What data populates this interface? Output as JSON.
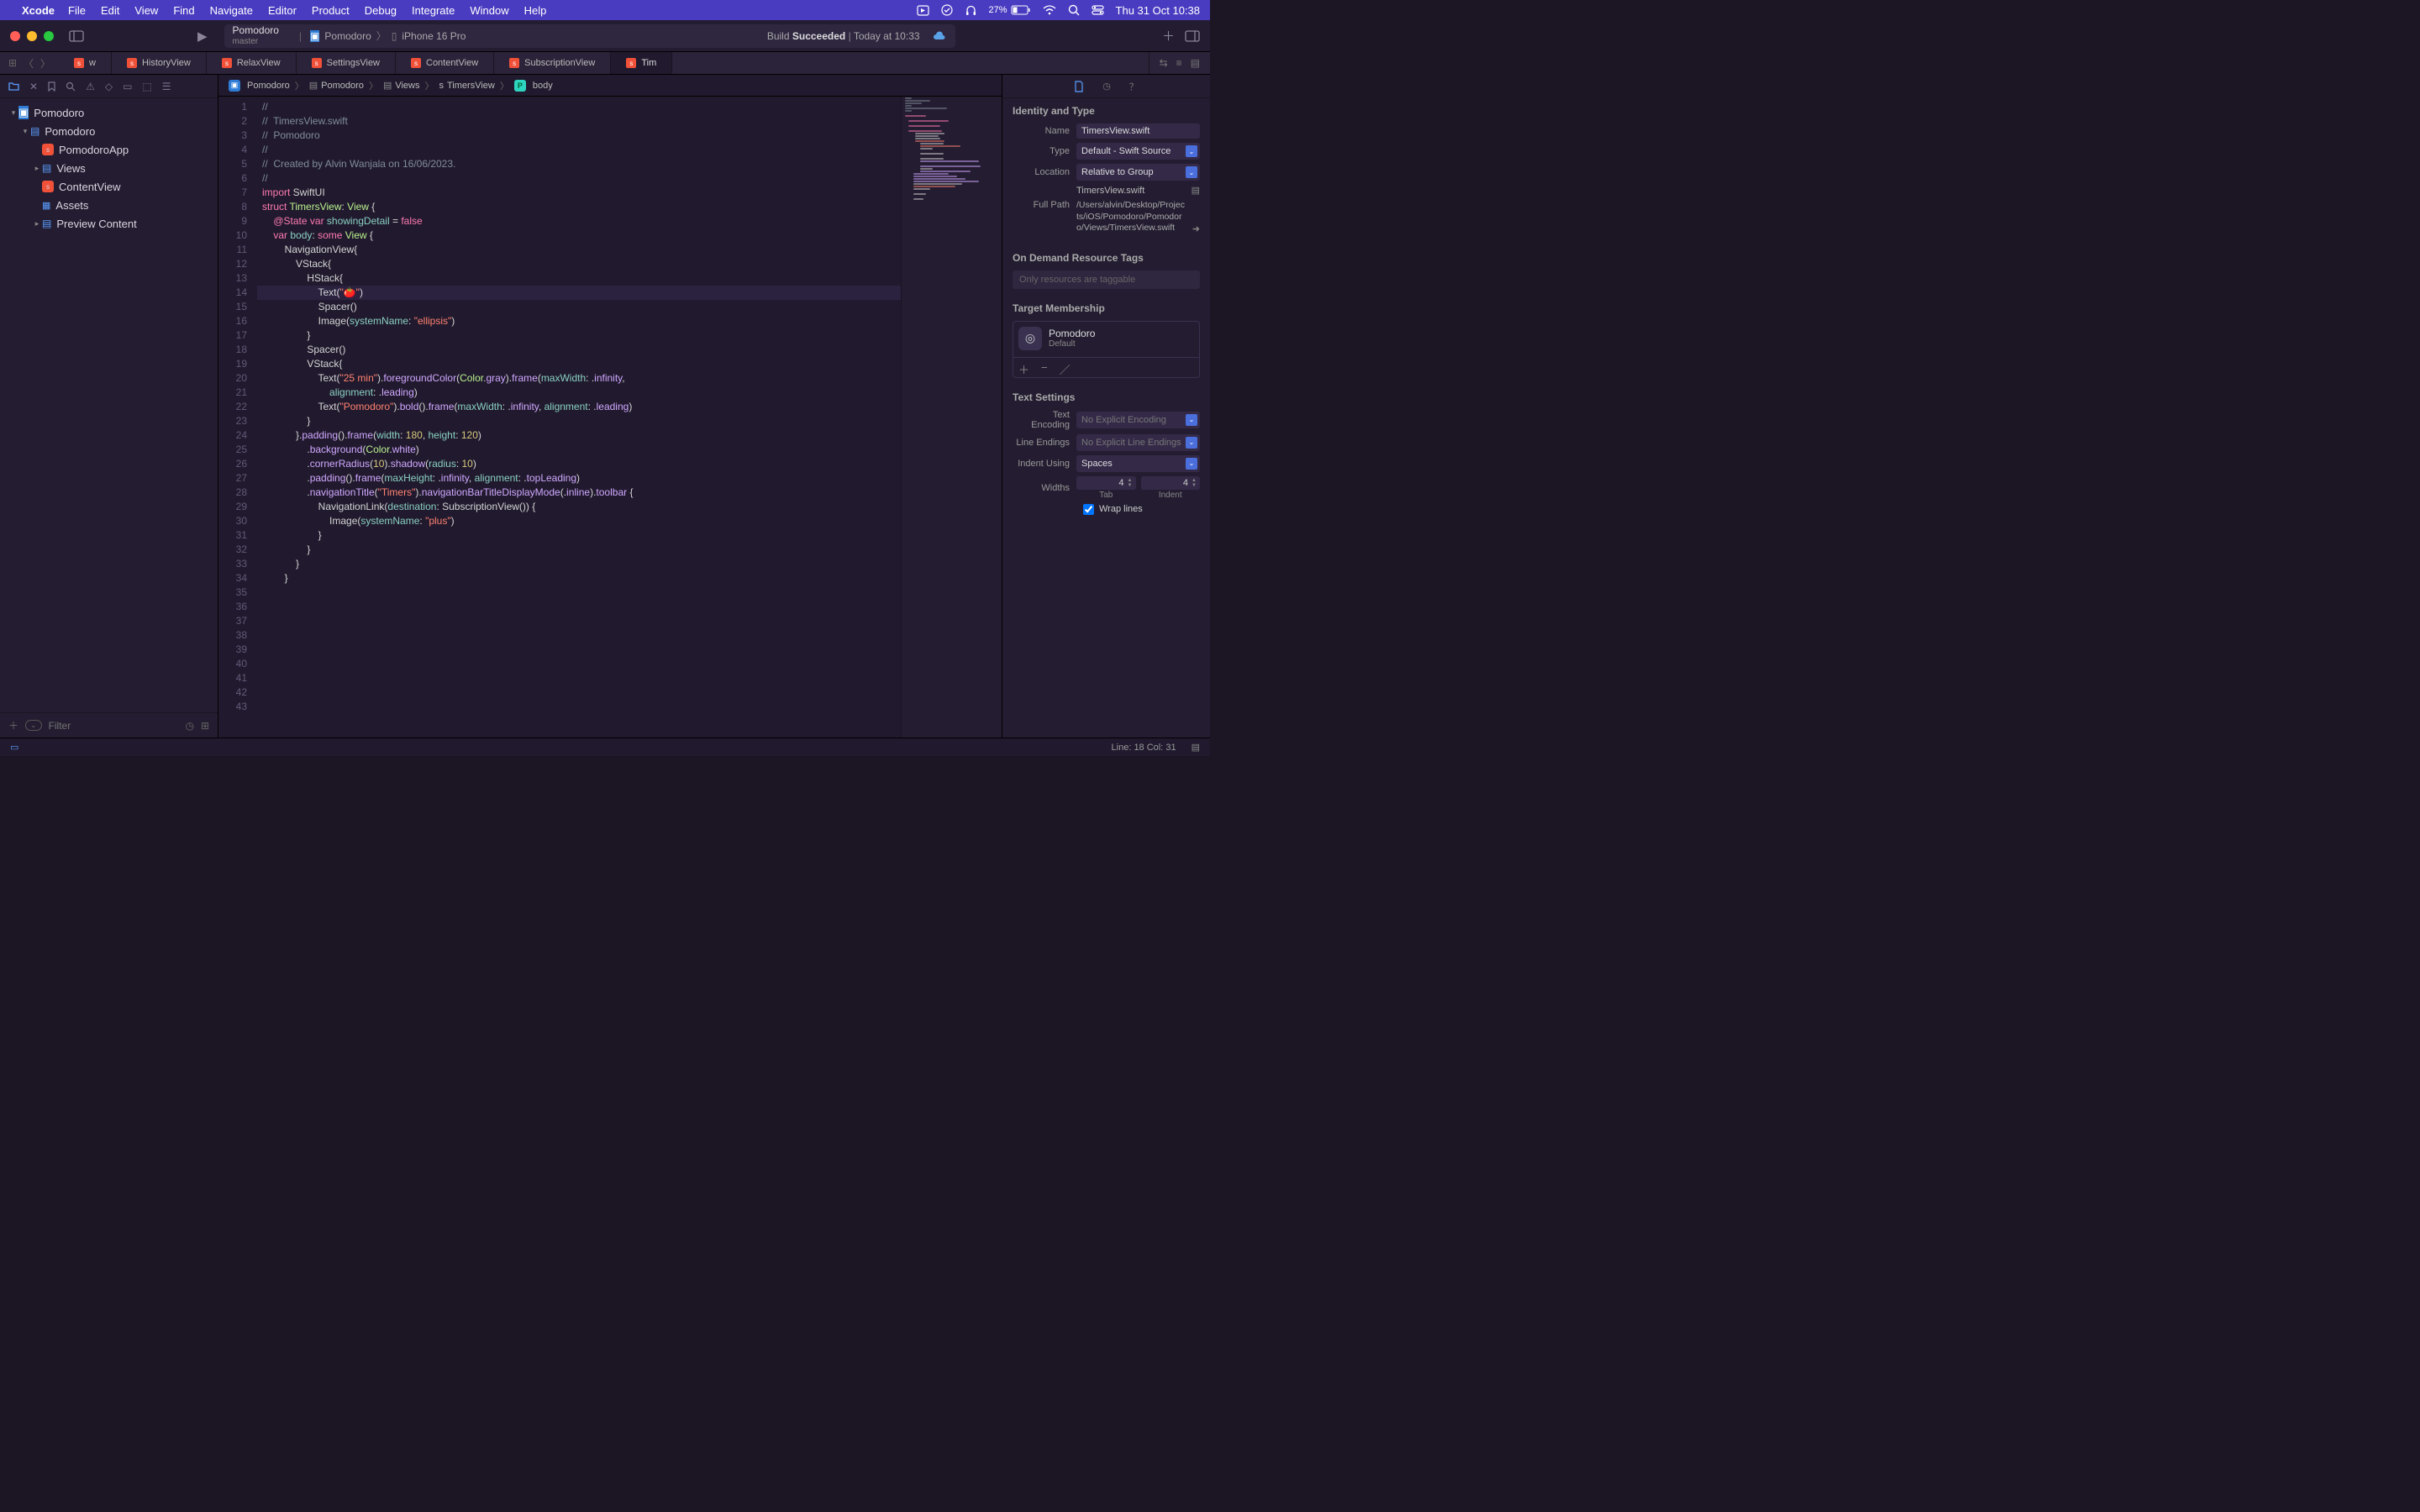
{
  "menubar": {
    "app": "Xcode",
    "items": [
      "File",
      "Edit",
      "View",
      "Find",
      "Navigate",
      "Editor",
      "Product",
      "Debug",
      "Integrate",
      "Window",
      "Help"
    ],
    "battery_pct": "27%",
    "datetime": "Thu 31 Oct  10:38"
  },
  "toolbar": {
    "project": "Pomodoro",
    "branch": "master",
    "scheme_app": "Pomodoro",
    "scheme_device": "iPhone 16 Pro",
    "build_label": "Build",
    "build_status": "Succeeded",
    "build_time": "Today at 10:33"
  },
  "tabs": [
    {
      "label": "w",
      "partial": true
    },
    {
      "label": "HistoryView"
    },
    {
      "label": "RelaxView"
    },
    {
      "label": "SettingsView"
    },
    {
      "label": "ContentView"
    },
    {
      "label": "SubscriptionView"
    },
    {
      "label": "Tim",
      "active": true,
      "partial": true
    }
  ],
  "navigator": {
    "tree": [
      {
        "depth": 0,
        "kind": "project",
        "label": "Pomodoro",
        "disclosed": true
      },
      {
        "depth": 1,
        "kind": "folder",
        "label": "Pomodoro",
        "disclosed": true
      },
      {
        "depth": 2,
        "kind": "swift",
        "label": "PomodoroApp"
      },
      {
        "depth": 2,
        "kind": "folder",
        "label": "Views",
        "disclosed": false,
        "haschild": true
      },
      {
        "depth": 2,
        "kind": "swift",
        "label": "ContentView"
      },
      {
        "depth": 2,
        "kind": "assets",
        "label": "Assets"
      },
      {
        "depth": 2,
        "kind": "folder",
        "label": "Preview Content",
        "disclosed": false,
        "haschild": true
      }
    ],
    "filter_placeholder": "Filter"
  },
  "breadcrumb": [
    "Pomodoro",
    "Pomodoro",
    "Views",
    "TimersView",
    "body"
  ],
  "code": {
    "cursor": {
      "line": 18,
      "col": 31
    },
    "lines": [
      {
        "n": 1,
        "html": "<span class='c'>//</span>"
      },
      {
        "n": 2,
        "html": "<span class='c'>//  TimersView.swift</span>"
      },
      {
        "n": 3,
        "html": "<span class='c'>//  Pomodoro</span>"
      },
      {
        "n": 4,
        "html": "<span class='c'>//</span>"
      },
      {
        "n": 5,
        "html": "<span class='c'>//  Created by Alvin Wanjala on 16/06/2023.</span>"
      },
      {
        "n": 6,
        "html": "<span class='c'>//</span>"
      },
      {
        "n": 7,
        "html": ""
      },
      {
        "n": 8,
        "html": "<span class='k'>import</span> SwiftUI"
      },
      {
        "n": 9,
        "html": ""
      },
      {
        "n": 10,
        "html": "<span class='k'>struct</span> <span class='type'>TimersView</span>: <span class='type'>View</span> {"
      },
      {
        "n": 11,
        "html": ""
      },
      {
        "n": 12,
        "html": "    <span class='k'>@State</span> <span class='k'>var</span> <span class='prop'>showingDetail</span> = <span class='k'>false</span>"
      },
      {
        "n": 13,
        "html": ""
      },
      {
        "n": 14,
        "html": "    <span class='k'>var</span> <span class='prop'>body</span>: <span class='k'>some</span> <span class='type'>View</span> {"
      },
      {
        "n": 15,
        "html": "        NavigationView{"
      },
      {
        "n": 16,
        "html": "            VStack{"
      },
      {
        "n": 17,
        "html": "                HStack{"
      },
      {
        "n": 18,
        "hl": true,
        "html": "                    Text(<span class='str'>\"🍅\"</span>)"
      },
      {
        "n": 19,
        "html": "                    Spacer()"
      },
      {
        "n": 20,
        "html": "                    Image(<span class='arg'>systemName</span>: <span class='str'>\"ellipsis\"</span>)"
      },
      {
        "n": 21,
        "html": "                }"
      },
      {
        "n": 22,
        "html": ""
      },
      {
        "n": 23,
        "html": "                Spacer()"
      },
      {
        "n": 24,
        "html": ""
      },
      {
        "n": 25,
        "html": "                VStack{"
      },
      {
        "n": 26,
        "html": "                    Text(<span class='str'>\"25 min\"</span>).<span class='call'>foregroundColor</span>(<span class='type'>Color</span>.<span class='call'>gray</span>).<span class='call'>frame</span>(<span class='arg'>maxWidth</span>: .<span class='enum'>infinity</span>,\n                        <span class='arg'>alignment</span>: .<span class='enum'>leading</span>)"
      },
      {
        "n": 27,
        "html": ""
      },
      {
        "n": 28,
        "html": "                    Text(<span class='str'>\"Pomodoro\"</span>).<span class='call'>bold</span>().<span class='call'>frame</span>(<span class='arg'>maxWidth</span>: .<span class='enum'>infinity</span>, <span class='arg'>alignment</span>: .<span class='enum'>leading</span>)"
      },
      {
        "n": 29,
        "html": "                }"
      },
      {
        "n": 30,
        "html": "            }.<span class='call'>padding</span>().<span class='call'>frame</span>(<span class='arg'>width</span>: <span class='num'>180</span>, <span class='arg'>height</span>: <span class='num'>120</span>)"
      },
      {
        "n": 31,
        "html": "                .<span class='call'>background</span>(<span class='type'>Color</span>.<span class='call'>white</span>)"
      },
      {
        "n": 32,
        "html": "                .<span class='call'>cornerRadius</span>(<span class='num'>10</span>).<span class='call'>shadow</span>(<span class='arg'>radius</span>: <span class='num'>10</span>)"
      },
      {
        "n": 33,
        "html": "                .<span class='call'>padding</span>().<span class='call'>frame</span>(<span class='arg'>maxHeight</span>: .<span class='enum'>infinity</span>, <span class='arg'>alignment</span>: .<span class='enum'>topLeading</span>)"
      },
      {
        "n": 34,
        "html": "                .<span class='call'>navigationTitle</span>(<span class='str'>\"Timers\"</span>).<span class='call'>navigationBarTitleDisplayMode</span>(.<span class='enum'>inline</span>).<span class='call'>toolbar</span> {"
      },
      {
        "n": 35,
        "html": "                    NavigationLink(<span class='arg'>destination</span>: SubscriptionView()) {"
      },
      {
        "n": 36,
        "html": "                        Image(<span class='arg'>systemName</span>: <span class='str'>\"plus\"</span>)"
      },
      {
        "n": 37,
        "html": "                    }"
      },
      {
        "n": 38,
        "html": ""
      },
      {
        "n": 39,
        "html": "                }"
      },
      {
        "n": 40,
        "html": ""
      },
      {
        "n": 41,
        "html": "            }"
      },
      {
        "n": 42,
        "html": ""
      },
      {
        "n": 43,
        "html": "        }"
      }
    ]
  },
  "inspector": {
    "identity_title": "Identity and Type",
    "name_label": "Name",
    "name_value": "TimersView.swift",
    "type_label": "Type",
    "type_value": "Default - Swift Source",
    "location_label": "Location",
    "location_value": "Relative to Group",
    "location_file": "TimersView.swift",
    "fullpath_label": "Full Path",
    "fullpath_value": "/Users/alvin/Desktop/Projects/iOS/Pomodoro/Pomodoro/Views/TimersView.swift",
    "odr_title": "On Demand Resource Tags",
    "odr_placeholder": "Only resources are taggable",
    "target_title": "Target Membership",
    "target_name": "Pomodoro",
    "target_role": "Default",
    "text_title": "Text Settings",
    "encoding_label": "Text Encoding",
    "encoding_value": "No Explicit Encoding",
    "endings_label": "Line Endings",
    "endings_value": "No Explicit Line Endings",
    "indent_using_label": "Indent Using",
    "indent_using_value": "Spaces",
    "widths_label": "Widths",
    "tab_width": "4",
    "indent_width": "4",
    "tab_sub": "Tab",
    "indent_sub": "Indent",
    "wrap_label": "Wrap lines"
  },
  "statusbar": {
    "cursor_label": "Line: 18  Col: 31"
  }
}
